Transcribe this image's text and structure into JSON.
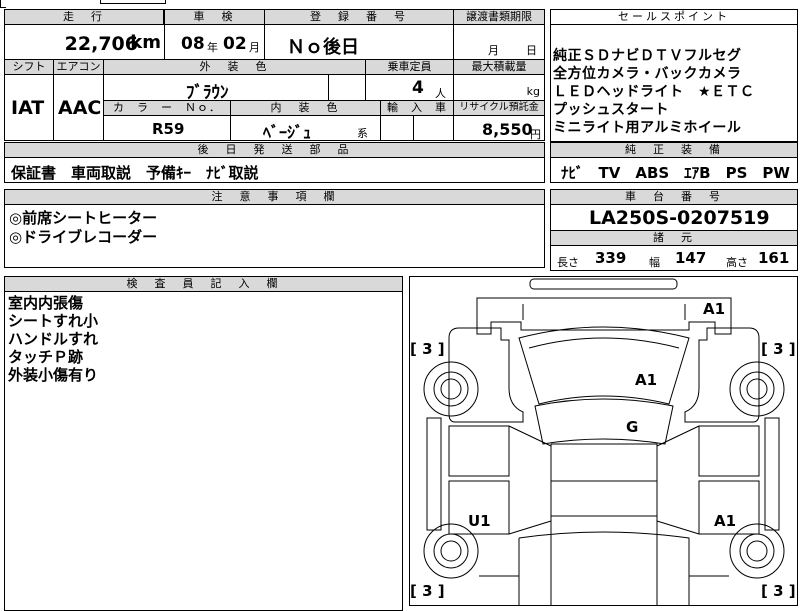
{
  "header": {
    "mileage_label": "走　行",
    "inspection_label": "車　検",
    "registration_label": "登　録　番　号",
    "transfer_deadline_label": "譲渡書類期限",
    "sales_point_label": "セールスポイント"
  },
  "vehicle": {
    "mileage": "22,706",
    "mileage_unit": "km",
    "inspection_year": "08",
    "inspection_year_unit": "年",
    "inspection_month": "02",
    "inspection_month_unit": "月",
    "registration_number": "Ｎｏ後日",
    "deadline_month_unit": "月",
    "deadline_day_unit": "日",
    "shift_label": "シフト",
    "aircon_label": "エアコン",
    "ext_color_label": "外　装　色",
    "capacity_label": "乗車定員",
    "max_load_label": "最大積載量",
    "shift": "IAT",
    "aircon": "AAC",
    "ext_color": "ﾌﾞﾗｳﾝ",
    "capacity": "4",
    "capacity_unit": "人",
    "max_load_unit": "kg",
    "color_no_label": "カ　ラ　ー　Ｎｏ．",
    "int_color_label": "内　装　色",
    "import_label": "輸　入　車",
    "recycle_label": "リサイクル預託金",
    "color_no": "R59",
    "int_color": "ﾍﾞｰｼﾞｭ",
    "int_color_suffix": "系",
    "recycle_fee": "8,550",
    "recycle_unit": "円"
  },
  "sales_points": [
    "純正ＳＤナビＤＴＶフルセグ",
    "全方位カメラ・バックカメラ",
    "ＬＥＤヘッドライト　★ＥＴＣ",
    "プッシュスタート",
    "ミニライト用アルミホイール"
  ],
  "later_parts": {
    "label": "後　日　発　送　部　品",
    "value": "保証書　車両取説　予備ｷｰ　ﾅﾋﾞ取説"
  },
  "genuine_equipment": {
    "label": "純　正　装　備",
    "value": "ﾅﾋﾞ　TV　ABS　ｴｱB　PS　PW"
  },
  "notes": {
    "label": "注　意　事　項　欄",
    "items": [
      "◎前席シートヒーター",
      "◎ドライブレコーダー"
    ]
  },
  "chassis": {
    "label": "車　台　番　号",
    "value": "LA250S-0207519",
    "spec_label": "諸　元",
    "length_label": "長さ",
    "length": "339",
    "width_label": "幅",
    "width": "147",
    "height_label": "高さ",
    "height": "161"
  },
  "inspector": {
    "label": "検　査　員　記　入　欄",
    "items": [
      "室内内張傷",
      "シートすれ小",
      "ハンドルすれ",
      "タッチＰ跡",
      "外装小傷有り"
    ]
  },
  "diagram": {
    "marks": [
      "A1",
      "A1",
      "G",
      "U1",
      "A1"
    ],
    "tire_labels": [
      "[ 3 ]",
      "[ 3 ]",
      "[ 3 ]",
      "[ 3 ]"
    ]
  }
}
